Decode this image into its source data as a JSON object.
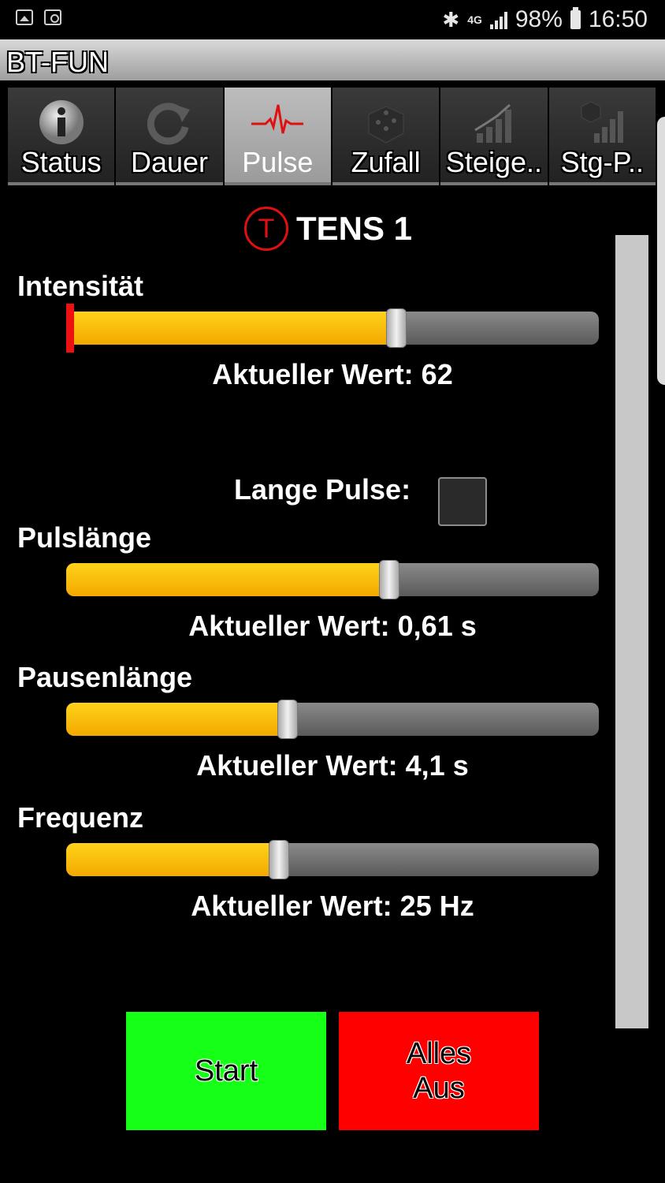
{
  "status_bar": {
    "battery": "98%",
    "time": "16:50",
    "network": "4G"
  },
  "app": {
    "title": "BT-FUN"
  },
  "tabs": [
    {
      "label": "Status",
      "icon": "info-icon"
    },
    {
      "label": "Dauer",
      "icon": "refresh-icon"
    },
    {
      "label": "Pulse",
      "icon": "pulse-icon",
      "active": true
    },
    {
      "label": "Zufall",
      "icon": "dice-icon"
    },
    {
      "label": "Steige..",
      "icon": "bar-chart-icon"
    },
    {
      "label": "Stg-P..",
      "icon": "dice-chart-icon"
    }
  ],
  "device": {
    "badge": "T",
    "name": "TENS 1"
  },
  "sliders": {
    "intensity": {
      "label": "Intensität",
      "value_text": "Aktueller Wert: 62",
      "level": 0.62
    },
    "pulse_length": {
      "label": "Pulslänge",
      "value_text": "Aktueller Wert: 0,61 s",
      "level": 0.606
    },
    "pause_length": {
      "label": "Pausenlänge",
      "value_text": "Aktueller Wert: 4,1 s",
      "level": 0.416
    },
    "frequency": {
      "label": "Frequenz",
      "value_text": "Aktueller Wert: 25 Hz",
      "level": 0.399
    }
  },
  "long_pulse": {
    "label": "Lange Pulse:",
    "checked": false
  },
  "buttons": {
    "start": "Start",
    "stop_line1": "Alles",
    "stop_line2": "Aus"
  },
  "colors": {
    "fill": "#ffc400",
    "start": "#16ff16",
    "stop": "#ff0000",
    "accent": "#e01010"
  }
}
